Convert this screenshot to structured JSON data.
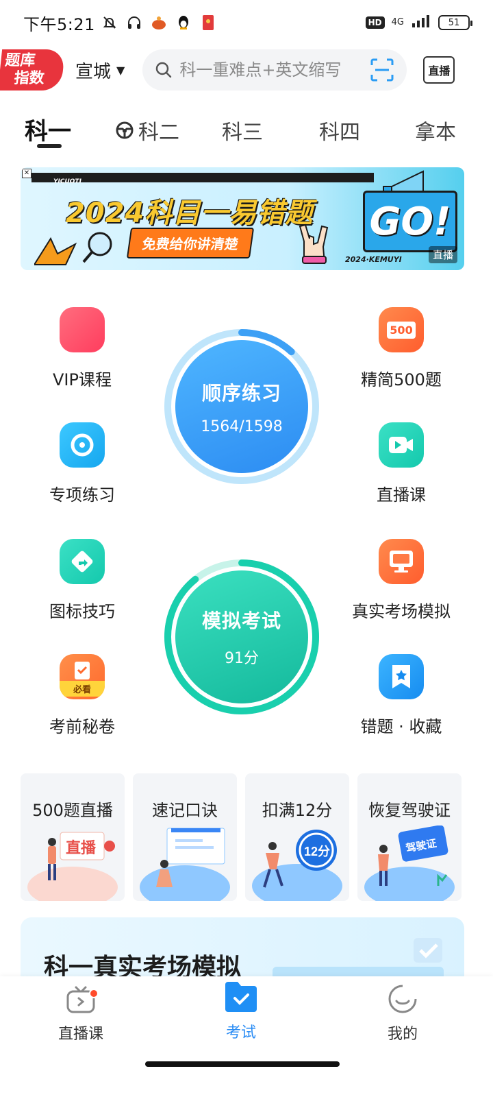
{
  "status_bar": {
    "time": "下午5:21",
    "network": "4G",
    "battery": "51",
    "hd": "HD"
  },
  "header": {
    "logo_line1": "题库",
    "logo_line2": "指数",
    "city": "宣城",
    "search_placeholder": "科一重难点+英文缩写",
    "live_label": "直播"
  },
  "tabs": [
    {
      "label": "科一",
      "active": true
    },
    {
      "label": "科二",
      "active": false
    },
    {
      "label": "科三",
      "active": false
    },
    {
      "label": "科四",
      "active": false
    },
    {
      "label": "拿本",
      "active": false
    }
  ],
  "banner": {
    "title": "2024科目一易错题",
    "subtitle": "免费给你讲清楚",
    "go_text": "GO!",
    "tag": "直播",
    "strip_text": "YICUOTI",
    "footer_text": "2024·KEMUYI"
  },
  "grid_left": [
    {
      "label": "VIP课程",
      "icon": "vip-icon",
      "color": "#ff4d6a"
    },
    {
      "label": "专项练习",
      "icon": "target-icon",
      "color": "#1fb6f5"
    },
    {
      "label": "图标技巧",
      "icon": "direction-sign-icon",
      "color": "#1fd4b8"
    },
    {
      "label": "考前秘卷",
      "icon": "exam-paper-icon",
      "color": "#ff7a3d",
      "badge": "必看"
    }
  ],
  "grid_right": [
    {
      "label": "精简500题",
      "icon": "500-icon",
      "color": "#ff6b3d",
      "badge": "500"
    },
    {
      "label": "直播课",
      "icon": "video-camera-icon",
      "color": "#1fd4b8"
    },
    {
      "label": "真实考场模拟",
      "icon": "monitor-icon",
      "color": "#ff6b3d"
    },
    {
      "label": "错题 · 收藏",
      "icon": "bookmark-star-icon",
      "color": "#1fa5f5"
    }
  ],
  "practice": {
    "title": "顺序练习",
    "progress": "1564/1598",
    "done": 1564,
    "total": 1598
  },
  "mock_exam": {
    "title": "模拟考试",
    "score": "91分",
    "score_value": 91,
    "max": 100
  },
  "quick_cards": [
    {
      "title": "500题直播",
      "art_text": "直播"
    },
    {
      "title": "速记口诀"
    },
    {
      "title": "扣满12分",
      "art_text": "12分"
    },
    {
      "title": "恢复驾驶证",
      "art_text": "驾驶证"
    }
  ],
  "sim_card": {
    "title": "科一真实考场模拟"
  },
  "bottom_nav": [
    {
      "label": "直播课",
      "icon": "live-tv-icon",
      "active": false,
      "dot": true
    },
    {
      "label": "考试",
      "icon": "exam-folder-icon",
      "active": true
    },
    {
      "label": "我的",
      "icon": "profile-face-icon",
      "active": false
    }
  ]
}
